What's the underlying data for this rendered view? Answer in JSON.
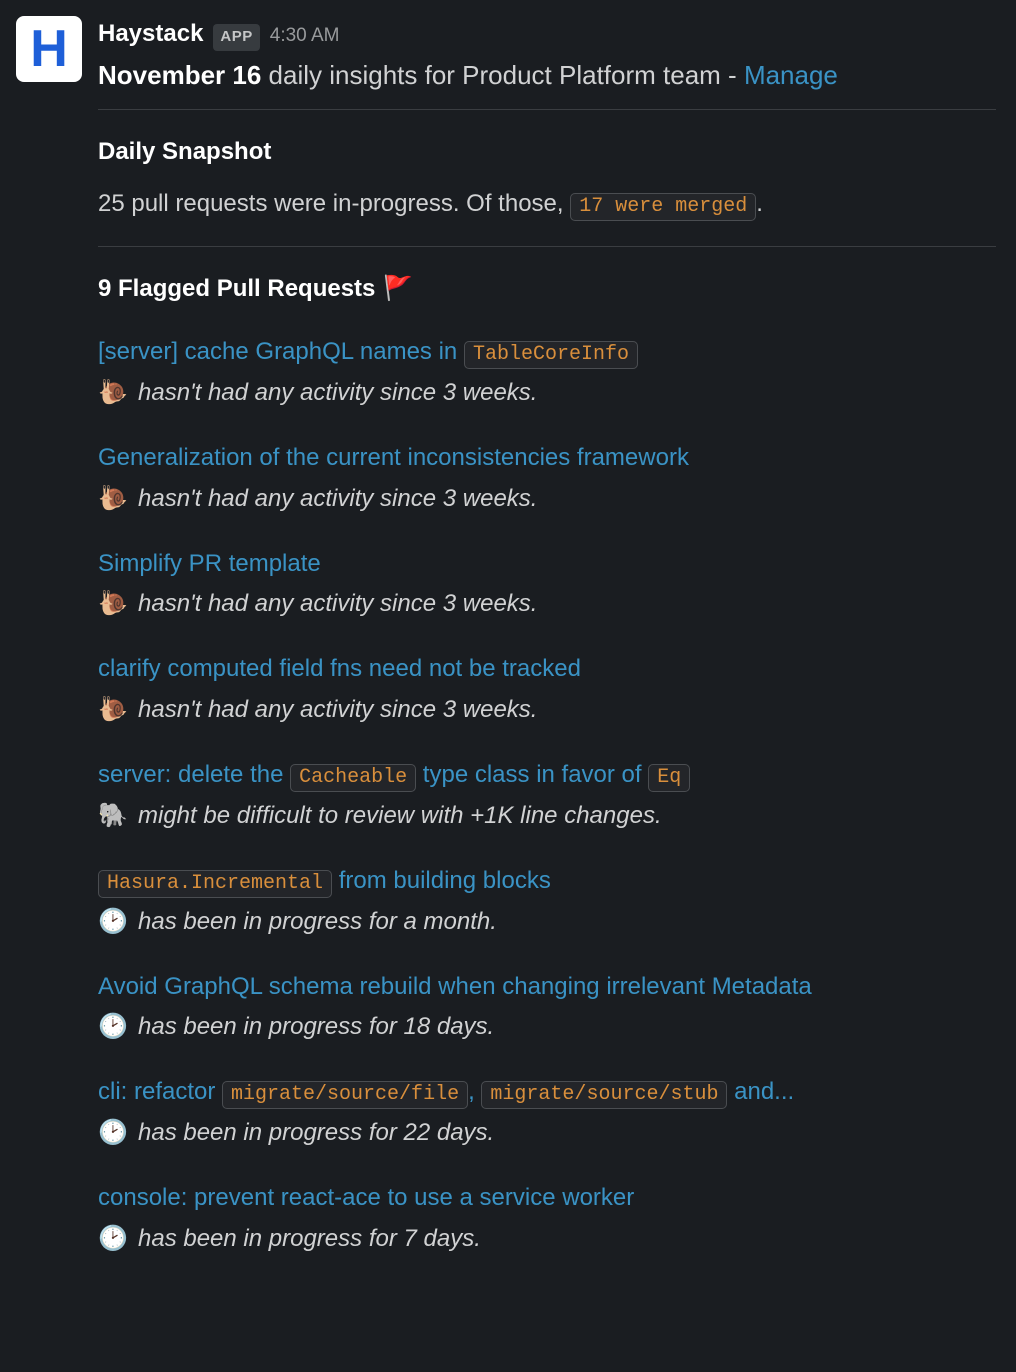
{
  "header": {
    "avatar_letter": "H",
    "author": "Haystack",
    "app_badge": "APP",
    "timestamp": "4:30 AM"
  },
  "headline": {
    "date": "November 16",
    "rest": " daily insights for Product Platform team - ",
    "manage_label": "Manage"
  },
  "snapshot": {
    "title": "Daily Snapshot",
    "prefix": "25 pull requests were in-progress. Of those, ",
    "chip": "17 were merged",
    "suffix": "."
  },
  "flagged": {
    "title_text": "9 Flagged Pull Requests ",
    "flag_emoji": "🚩"
  },
  "prs": [
    {
      "title_parts": [
        {
          "type": "text",
          "value": "[server] cache GraphQL names in "
        },
        {
          "type": "code",
          "value": "TableCoreInfo"
        }
      ],
      "status_emoji": "🐌",
      "status_text": "hasn't had any activity since 3 weeks."
    },
    {
      "title_parts": [
        {
          "type": "text",
          "value": "Generalization of the current inconsistencies framework"
        }
      ],
      "status_emoji": "🐌",
      "status_text": "hasn't had any activity since 3 weeks."
    },
    {
      "title_parts": [
        {
          "type": "text",
          "value": "Simplify PR template"
        }
      ],
      "status_emoji": "🐌",
      "status_text": "hasn't had any activity since 3 weeks."
    },
    {
      "title_parts": [
        {
          "type": "text",
          "value": "clarify computed field fns need not be tracked"
        }
      ],
      "status_emoji": "🐌",
      "status_text": "hasn't had any activity since 3 weeks."
    },
    {
      "title_parts": [
        {
          "type": "text",
          "value": "server: delete the "
        },
        {
          "type": "code",
          "value": "Cacheable"
        },
        {
          "type": "text",
          "value": " type class in favor of "
        },
        {
          "type": "code",
          "value": "Eq"
        }
      ],
      "status_emoji": "🐘",
      "status_text": "might be difficult to review with +1K line changes."
    },
    {
      "title_parts": [
        {
          "type": "code",
          "value": "Hasura.Incremental"
        },
        {
          "type": "text",
          "value": " from building blocks"
        }
      ],
      "status_emoji": "🕑",
      "status_text": "has been in progress for a month."
    },
    {
      "title_parts": [
        {
          "type": "text",
          "value": "Avoid GraphQL schema rebuild when changing irrelevant Metadata"
        }
      ],
      "status_emoji": "🕑",
      "status_text": "has been in progress for 18 days."
    },
    {
      "title_parts": [
        {
          "type": "text",
          "value": "cli: refactor "
        },
        {
          "type": "code",
          "value": "migrate/source/file"
        },
        {
          "type": "text",
          "value": ", "
        },
        {
          "type": "code",
          "value": "migrate/source/stub"
        },
        {
          "type": "text",
          "value": " and..."
        }
      ],
      "status_emoji": "🕑",
      "status_text": "has been in progress for 22 days."
    },
    {
      "title_parts": [
        {
          "type": "text",
          "value": "console: prevent react-ace to use a service worker"
        }
      ],
      "status_emoji": "🕑",
      "status_text": "has been in progress for 7 days."
    }
  ]
}
